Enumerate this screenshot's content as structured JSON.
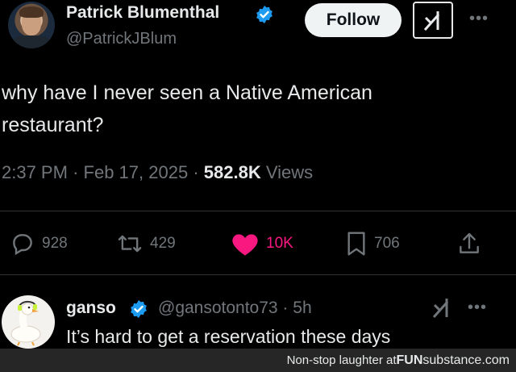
{
  "tweet": {
    "author_name": "Patrick Blumenthal",
    "handle": "@PatrickJBlum",
    "follow_label": "Follow",
    "more_icon": "more-horizontal-icon",
    "text_line1": "why have I never seen a Native American",
    "text_line2": "restaurant?",
    "time": "2:37 PM",
    "sep1": "·",
    "date": "Feb 17, 2025",
    "sep2": "·",
    "views_count": "582.8K",
    "views_label": "Views",
    "actions": {
      "replies": "928",
      "reposts": "429",
      "likes": "10K",
      "bookmarks": "706"
    },
    "colors": {
      "background": "#000000",
      "text": "#e7e9ea",
      "muted": "#71767b",
      "like": "#f91880",
      "verified": "#1d9bf0"
    }
  },
  "reply": {
    "author_name": "ganso",
    "handle_time": "@gansotonto73 · 5h",
    "text": "It’s hard to get a reservation these days"
  },
  "footer": {
    "caption": "Non-stop laughter at ",
    "brand_bold": "FUN",
    "brand_rest": "substance.com"
  }
}
